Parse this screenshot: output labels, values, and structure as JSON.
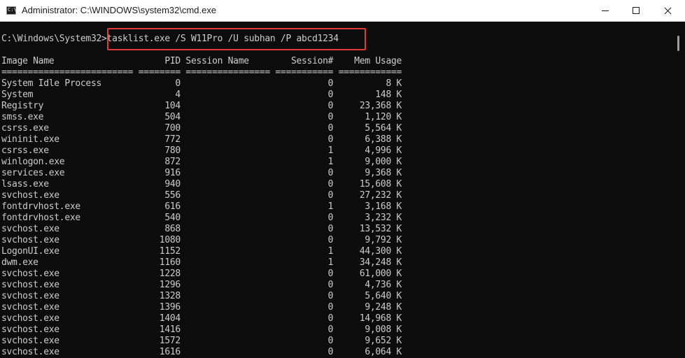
{
  "window": {
    "title": "Administrator: C:\\WINDOWS\\system32\\cmd.exe",
    "icon": "cmd-icon",
    "controls": [
      "minimize-icon",
      "maximize-icon",
      "close-icon"
    ]
  },
  "console": {
    "prompt": "C:\\Windows\\System32>",
    "command": "tasklist.exe /S W11Pro /U subhan /P abcd1234",
    "header": "Image Name                     PID Session Name        Session#    Mem Usage",
    "separator": "========================= ======== ================ =========== ============",
    "rows": [
      "System Idle Process              0                            0          8 K",
      "System                           4                            0        148 K",
      "Registry                       104                            0     23,368 K",
      "smss.exe                       504                            0      1,120 K",
      "csrss.exe                      700                            0      5,564 K",
      "wininit.exe                    772                            0      6,388 K",
      "csrss.exe                      780                            1      4,996 K",
      "winlogon.exe                   872                            1      9,000 K",
      "services.exe                   916                            0      9,368 K",
      "lsass.exe                      940                            0     15,608 K",
      "svchost.exe                    556                            0     27,232 K",
      "fontdrvhost.exe                616                            1      3,168 K",
      "fontdrvhost.exe                540                            0      3,232 K",
      "svchost.exe                    868                            0     13,532 K",
      "svchost.exe                   1080                            0      9,792 K",
      "LogonUI.exe                   1152                            1     44,300 K",
      "dwm.exe                       1160                            1     34,248 K",
      "svchost.exe                   1228                            0     61,000 K",
      "svchost.exe                   1296                            0      4,736 K",
      "svchost.exe                   1328                            0      5,640 K",
      "svchost.exe                   1396                            0      9,248 K",
      "svchost.exe                   1404                            0     14,968 K",
      "svchost.exe                   1416                            0      9,008 K",
      "svchost.exe                   1572                            0      9,652 K",
      "svchost.exe                   1616                            0      6,064 K"
    ]
  },
  "colors": {
    "console_bg": "#0c0c0c",
    "console_text": "#cccccc",
    "highlight_border": "#e53935"
  }
}
